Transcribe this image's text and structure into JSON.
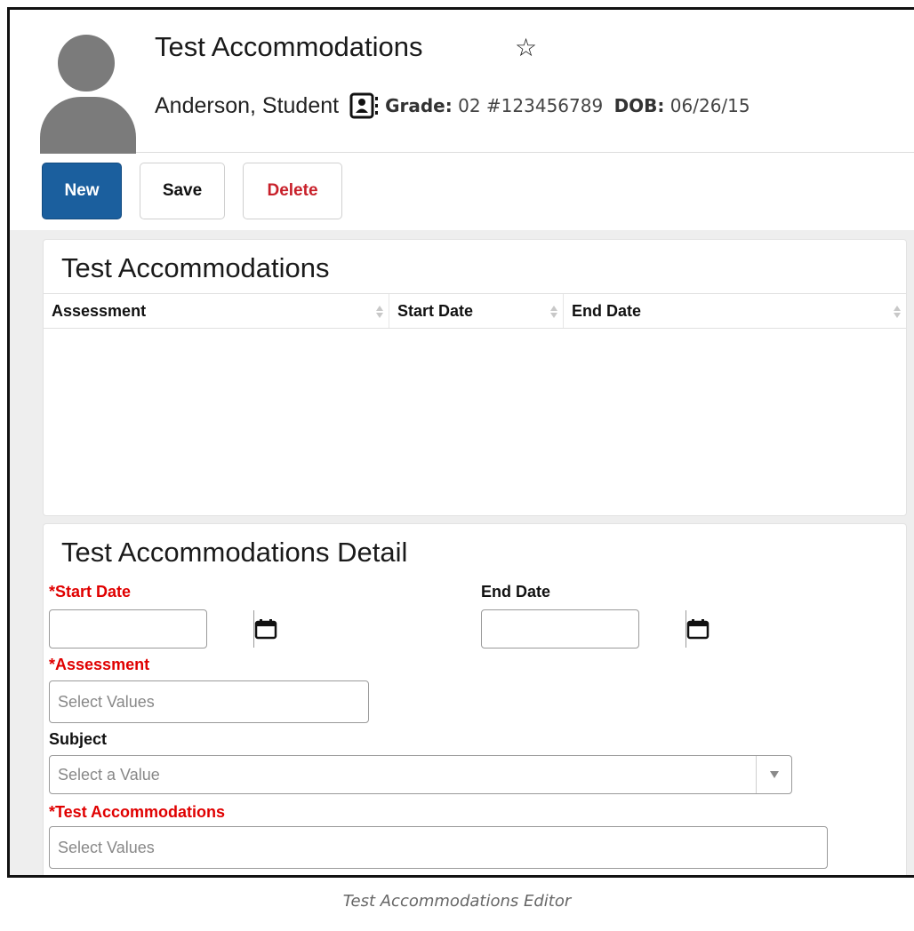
{
  "header": {
    "title": "Test Accommodations",
    "student_name": "Anderson, Student",
    "grade_label": "Grade:",
    "grade_value": "02",
    "student_number": "#123456789",
    "dob_label": "DOB:",
    "dob_value": "06/26/15"
  },
  "toolbar": {
    "new_label": "New",
    "save_label": "Save",
    "delete_label": "Delete"
  },
  "grid": {
    "title": "Test Accommodations",
    "columns": [
      "Assessment",
      "Start Date",
      "End Date"
    ],
    "rows": []
  },
  "detail": {
    "title": "Test Accommodations Detail",
    "start_date": {
      "label": "Start Date",
      "required": true,
      "value": ""
    },
    "end_date": {
      "label": "End Date",
      "required": false,
      "value": ""
    },
    "assessment": {
      "label": "Assessment",
      "required": true,
      "placeholder": "Select Values"
    },
    "subject": {
      "label": "Subject",
      "required": false,
      "placeholder": "Select a Value"
    },
    "test_accommodations": {
      "label": "Test Accommodations",
      "required": true,
      "placeholder": "Select Values"
    },
    "required_marker": "*"
  },
  "caption": "Test Accommodations Editor",
  "colors": {
    "primary": "#1b5f9e",
    "danger": "#c8202a",
    "required": "#e00000"
  }
}
